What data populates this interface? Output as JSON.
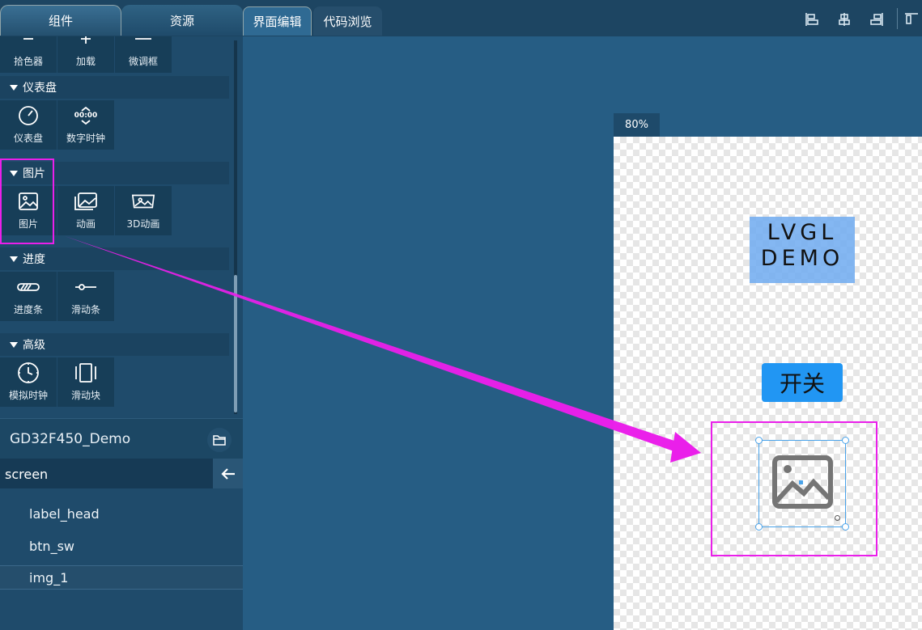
{
  "panel_tabs": {
    "components": "组件",
    "resources": "资源"
  },
  "editor_tabs": {
    "ui_edit": "界面编辑",
    "code_view": "代码浏览"
  },
  "partial_row": [
    "拾色器",
    "加载",
    "微调框"
  ],
  "sections": {
    "gauge": {
      "title": "仪表盘",
      "items": [
        "仪表盘",
        "数字时钟"
      ]
    },
    "image": {
      "title": "图片",
      "items": [
        "图片",
        "动画",
        "3D动画"
      ]
    },
    "progress": {
      "title": "进度",
      "items": [
        "进度条",
        "滑动条"
      ]
    },
    "advanced": {
      "title": "高级",
      "items": [
        "模拟时钟",
        "滑动块"
      ]
    }
  },
  "digital_clock_text": "00:00",
  "project": {
    "name": "GD32F450_Demo"
  },
  "tree": {
    "root": "screen",
    "items": [
      "label_head",
      "btn_sw",
      "img_1"
    ],
    "selected": "img_1"
  },
  "canvas": {
    "zoom": "80%",
    "label_line1": "LVGL",
    "label_line2": "DEMO",
    "button_text": "开关"
  },
  "colors": {
    "annotation": "#ea1fea",
    "button": "#2196f3",
    "selection": "#4aa3ea"
  },
  "icons": [
    "eyedropper-icon",
    "loading-icon",
    "spinbox-icon",
    "gauge-icon",
    "digital-clock-icon",
    "image-icon",
    "animation-icon",
    "3d-animation-icon",
    "progress-bar-icon",
    "slider-icon",
    "analog-clock-icon",
    "scroll-block-icon",
    "folder-icon",
    "back-arrow-icon",
    "align-left-icon",
    "align-center-icon",
    "align-right-icon",
    "align-top-icon"
  ]
}
